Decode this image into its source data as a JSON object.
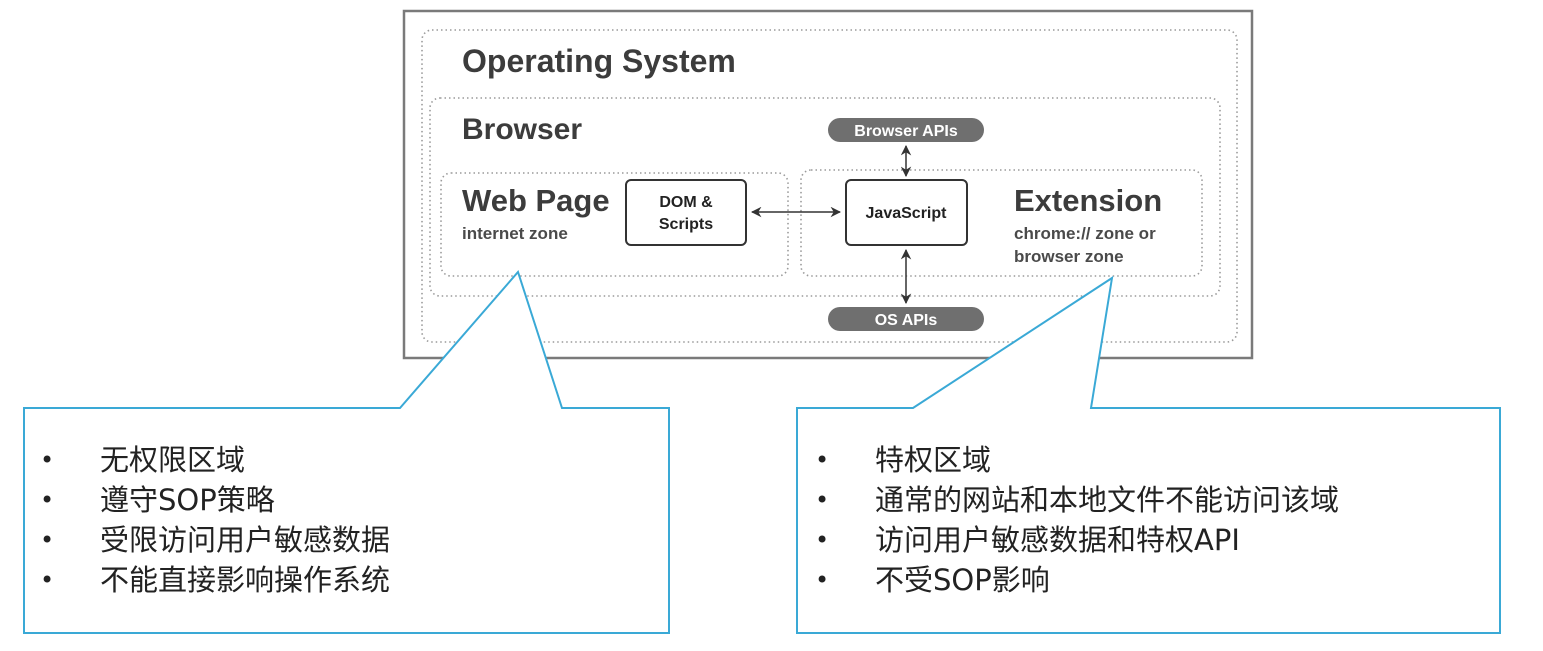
{
  "diagram": {
    "os_title": "Operating System",
    "browser_title": "Browser",
    "web_page": {
      "title": "Web Page",
      "subtitle": "internet zone",
      "box_line1": "DOM &",
      "box_line2": "Scripts"
    },
    "extension": {
      "title": "Extension",
      "subtitle_line1": "chrome:// zone or",
      "subtitle_line2": "browser zone",
      "box_label": "JavaScript"
    },
    "browser_apis": "Browser APIs",
    "os_apis": "OS APIs"
  },
  "callouts": {
    "left": {
      "items": [
        "无权限区域",
        "遵守SOP策略",
        "受限访问用户敏感数据",
        "不能直接影响操作系统"
      ]
    },
    "right": {
      "items": [
        "特权区域",
        "通常的网站和本地文件不能访问该域",
        "访问用户敏感数据和特权API",
        "不受SOP影响"
      ]
    }
  },
  "colors": {
    "callout_border": "#3aa9d6",
    "pill_fill": "#6f6f6f",
    "frame_border": "#7a7a7a"
  }
}
